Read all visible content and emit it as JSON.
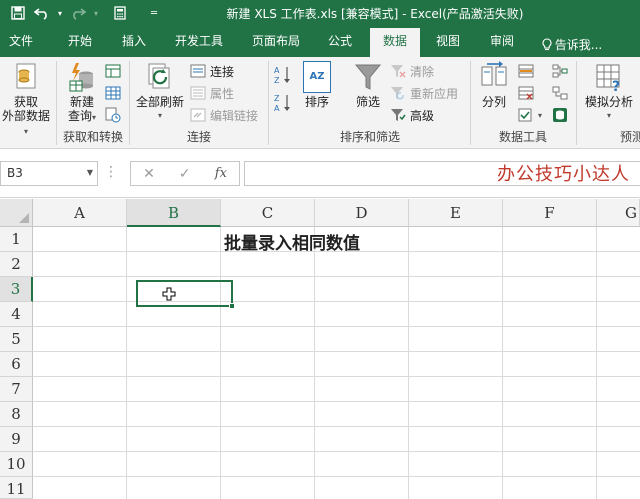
{
  "app": {
    "title": "新建 XLS 工作表.xls  [兼容模式] - Excel(产品激活失败)"
  },
  "qat": {
    "save_icon": "save-icon",
    "undo_icon": "undo-icon",
    "redo_icon": "redo-icon",
    "calc_icon": "calculator-icon"
  },
  "tabs": [
    {
      "label": "文件"
    },
    {
      "label": "开始"
    },
    {
      "label": "插入"
    },
    {
      "label": "开发工具"
    },
    {
      "label": "页面布局"
    },
    {
      "label": "公式"
    },
    {
      "label": "数据",
      "active": true
    },
    {
      "label": "视图"
    },
    {
      "label": "审阅"
    },
    {
      "label": "告诉我..."
    }
  ],
  "ribbon": {
    "get_external": {
      "label1": "获取",
      "label2": "外部数据"
    },
    "new_query": {
      "label1": "新建",
      "label2": "查询"
    },
    "group_get_transform": "获取和转换",
    "refresh_all": "全部刷新",
    "connections": "连接",
    "properties": "属性",
    "edit_links": "编辑链接",
    "group_connections": "连接",
    "sort_az": "AZ",
    "sort": "排序",
    "filter": "筛选",
    "clear": "清除",
    "reapply": "重新应用",
    "advanced": "高级",
    "group_sort_filter": "排序和筛选",
    "text_to_columns": "分列",
    "group_data_tools": "数据工具",
    "what_if": "模拟分析",
    "forecast_group": "预测"
  },
  "formula_bar": {
    "name_box": "B3",
    "fx": "fx",
    "cancel": "✕",
    "enter": "✓",
    "watermark": "办公技巧小达人"
  },
  "grid": {
    "columns": [
      "A",
      "B",
      "C",
      "D",
      "E",
      "F",
      "G"
    ],
    "rows": [
      "1",
      "2",
      "3",
      "4",
      "5",
      "6",
      "7",
      "8",
      "9",
      "10",
      "11"
    ],
    "selected_cell": "B3",
    "c1_text": "批量录入相同数值"
  },
  "colors": {
    "accent": "#217346",
    "watermark": "#c0392b"
  }
}
